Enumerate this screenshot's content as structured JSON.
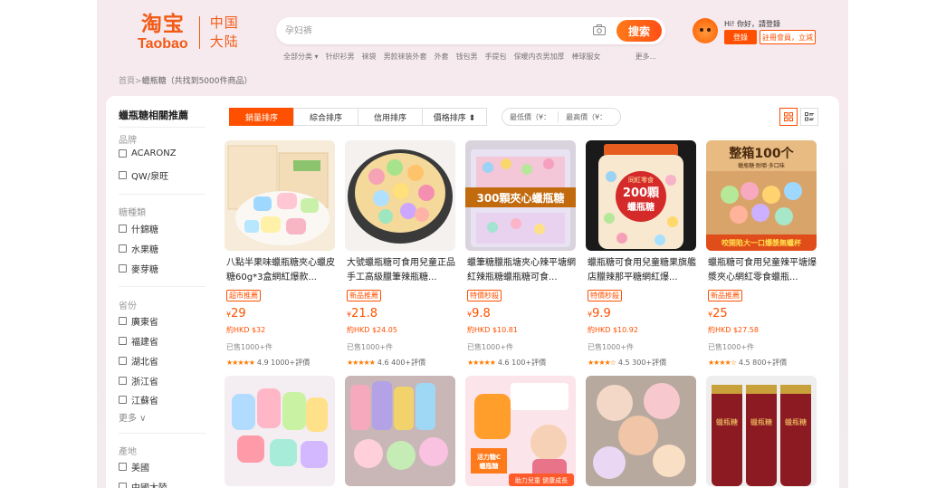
{
  "header": {
    "logo_cn": "淘宝",
    "logo_en": "Taobao",
    "region_line1": "中国",
    "region_line2": "大陆",
    "search_placeholder": "孕妇裤",
    "search_button": "搜索",
    "hotwords": [
      "全部分类 ▾",
      "针织衫男",
      "袜袋",
      "男款袜装外套",
      "外套",
      "钱包男",
      "手提包",
      "保暖内衣男加厚",
      "棒球服女"
    ],
    "hotwords_more": "更多...",
    "greeting": "Hi! 你好，請登錄",
    "login": "登錄",
    "register": "註冊會員，立減"
  },
  "breadcrumb": {
    "home": "首頁",
    "separator": ">",
    "current": "蠟瓶糖（共找到5000件商品）"
  },
  "sidebar": {
    "title": "蠟瓶糖相關推薦",
    "groups": [
      {
        "label": "品牌",
        "items": [
          "ACARONZ",
          "QW/泉旺"
        ]
      },
      {
        "label": "糖種類",
        "items": [
          "什錦糖",
          "水果糖",
          "麥芽糖"
        ]
      },
      {
        "label": "省份",
        "items": [
          "廣東省",
          "福建省",
          "湖北省",
          "浙江省",
          "江蘇省"
        ],
        "more": "更多 ∨"
      },
      {
        "label": "產地",
        "items": [
          "美國",
          "中國大陸"
        ]
      }
    ]
  },
  "sortbar": {
    "tabs": [
      "銷量排序",
      "綜合排序",
      "信用排序",
      "價格排序 ⬍"
    ],
    "price_min": "最低價（¥：",
    "price_max": "最高價（¥：",
    "colors": {
      "accent": "#ff5000"
    }
  },
  "products": [
    {
      "title": "八點半果味蠟瓶糖夾心蠟皮糖60g*3盒網紅爆款...",
      "tag": "超市推薦",
      "currency": "¥",
      "price": "29",
      "hkd": "約HKD $32",
      "sold": "已售1000+件",
      "stars": "★★★★★",
      "rating": "4.9",
      "reviews": "1000+評價"
    },
    {
      "title": "大號蠟瓶糖可食用兒童正品手工高級臘筆辣瓶糖...",
      "tag": "新品推薦",
      "currency": "¥",
      "price": "21.8",
      "hkd": "約HKD $24.05",
      "sold": "已售1000+件",
      "stars": "★★★★★",
      "rating": "4.6",
      "reviews": "400+評價"
    },
    {
      "title": "蠟筆糖臘瓶塘夾心辣平塘網紅辣瓶糖蠟瓶糖可食...",
      "tag": "特價秒殺",
      "currency": "¥",
      "price": "9.8",
      "hkd": "約HKD $10.81",
      "sold": "已售1000+件",
      "stars": "★★★★★",
      "rating": "4.6",
      "reviews": "100+評價"
    },
    {
      "title": "蠟瓶糖可食用兒童糖果旗艦店臘辣那平糖網紅爆...",
      "tag": "特價秒殺",
      "currency": "¥",
      "price": "9.9",
      "hkd": "約HKD $10.92",
      "sold": "已售1000+件",
      "stars": "★★★★☆",
      "rating": "4.5",
      "reviews": "300+評價"
    },
    {
      "title": "蠟瓶糖可食用兒童辣平塘爆漿夾心網紅零食蠟瓶...",
      "tag": "新品推薦",
      "currency": "¥",
      "price": "25",
      "hkd": "約HKD $27.58",
      "sold": "已售1000+件",
      "stars": "★★★★☆",
      "rating": "4.5",
      "reviews": "800+評價"
    }
  ],
  "image_texts": {
    "p3_banner": "300顆夾心蠟瓶糖",
    "p4_label_top": "同紅零食",
    "p4_label_mid": "200顆",
    "p4_label_bot": "蠟瓶糖",
    "p5_top": "整箱100个",
    "p5_sub": "蠟瓶糖·耐嚼·多口味",
    "p5_bottom": "咬開陷大一口爆漿無蠟杯",
    "p8_label": "活力糖C",
    "p8_label2": "蠟瓶糖",
    "p8_bottom": "助力兒童 健康成長",
    "p10_jar": "蠟瓶糖"
  }
}
